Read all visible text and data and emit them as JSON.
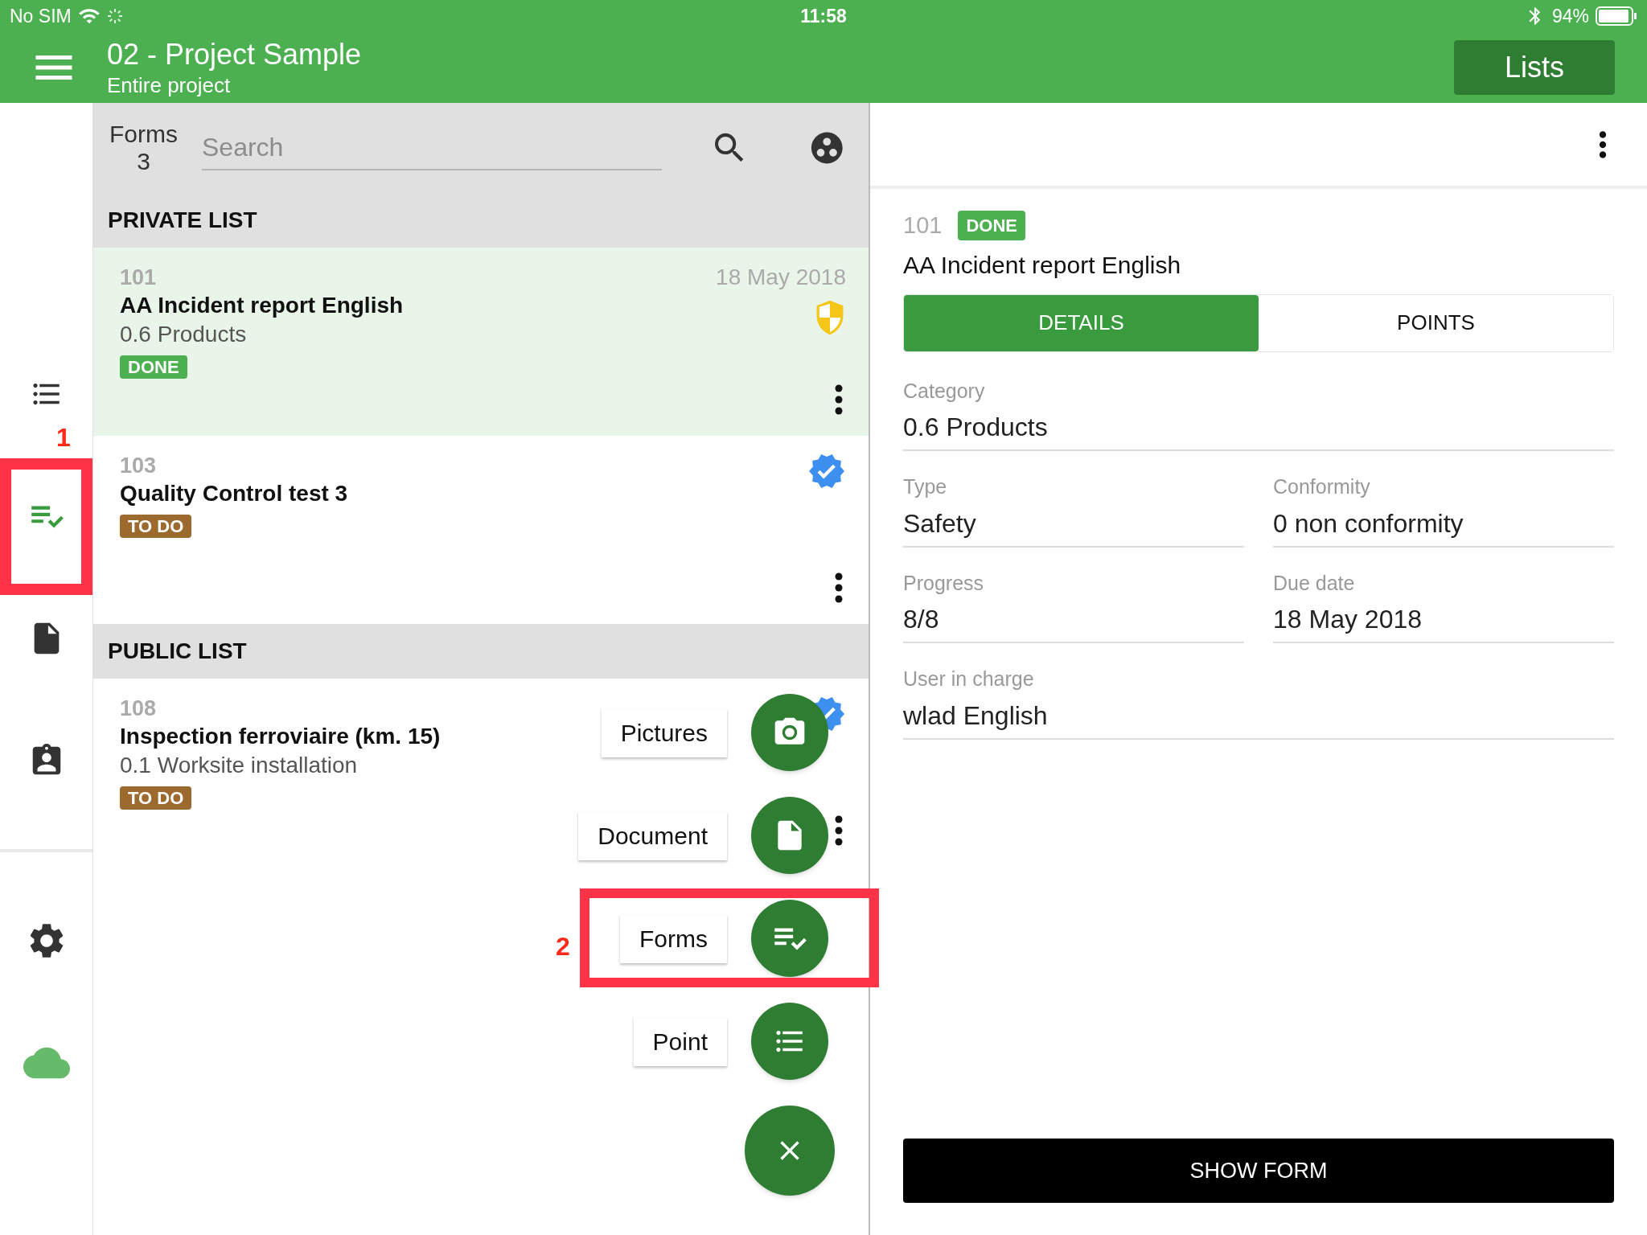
{
  "status_bar": {
    "carrier": "No SIM",
    "time": "11:58",
    "battery": "94%"
  },
  "header": {
    "title": "02 - Project Sample",
    "subtitle": "Entire project",
    "button": "Lists"
  },
  "rail": {
    "top": [
      {
        "kind": "points",
        "selected": false
      },
      {
        "kind": "forms",
        "selected": true
      },
      {
        "kind": "documents",
        "selected": false
      },
      {
        "kind": "contacts",
        "selected": false
      }
    ],
    "bottom": [
      {
        "kind": "settings",
        "selected": false
      },
      {
        "kind": "sync",
        "selected": false
      }
    ]
  },
  "list_header": {
    "label": "Forms",
    "count": "3",
    "search": {
      "placeholder": "Search"
    }
  },
  "sections": [
    {
      "title": "PRIVATE LIST",
      "items": [
        {
          "number": "101",
          "title": "AA Incident report English",
          "subtitle": "0.6 Products",
          "status": {
            "text": "DONE",
            "color": "#4caf50"
          },
          "date": "18 May 2018",
          "kind": "shield",
          "selected": true
        },
        {
          "number": "103",
          "title": "Quality Control test 3",
          "status": {
            "text": "TO DO",
            "color": "#9c6a2e"
          },
          "kind": "verified",
          "selected": false
        }
      ]
    },
    {
      "title": "PUBLIC LIST",
      "items": [
        {
          "number": "108",
          "title": "Inspection ferroviaire (km. 15)",
          "subtitle": "0.1 Worksite installation",
          "status": {
            "text": "TO DO",
            "color": "#9c6a2e"
          },
          "kind": "verified",
          "selected": false
        }
      ]
    }
  ],
  "fab_menu": {
    "actions": [
      {
        "kind": "camera",
        "label": "Pictures"
      },
      {
        "kind": "document",
        "label": "Document"
      },
      {
        "kind": "forms",
        "label": "Forms"
      },
      {
        "kind": "list",
        "label": "Point"
      }
    ]
  },
  "annotations": [
    {
      "kind": "rail",
      "label": "1"
    },
    {
      "kind": "fab",
      "label": "2"
    }
  ],
  "detail": {
    "number": "101",
    "status": {
      "text": "DONE",
      "color": "#4caf50"
    },
    "title": "AA Incident report English",
    "tabs": [
      {
        "label": "DETAILS",
        "selected": true
      },
      {
        "label": "POINTS",
        "selected": false
      }
    ],
    "field_rows": [
      [
        {
          "label": "Category",
          "value": "0.6 Products"
        }
      ],
      [
        {
          "label": "Type",
          "value": "Safety"
        },
        {
          "label": "Conformity",
          "value": "0 non conformity"
        }
      ],
      [
        {
          "label": "Progress",
          "value": "8/8"
        },
        {
          "label": "Due date",
          "value": "18 May 2018"
        }
      ],
      [
        {
          "label": "User in charge",
          "value": "wlad English"
        }
      ]
    ],
    "button": "SHOW FORM"
  }
}
